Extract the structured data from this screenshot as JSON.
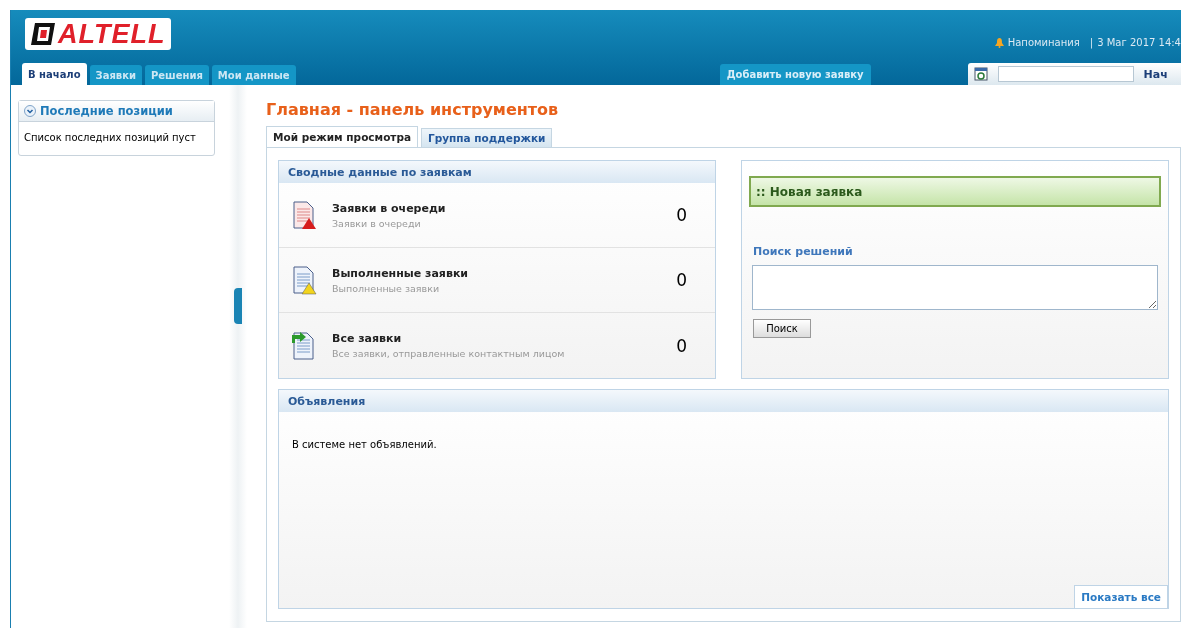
{
  "header": {
    "logo": "ALTELL",
    "reminders": "Напоминания",
    "separator": "|",
    "datetime": "3 Маг 2017 14:4",
    "add_button": "Добавить новую заявку",
    "search": {
      "button": "Нач"
    }
  },
  "nav_tabs": [
    {
      "label": "В начало",
      "selected": true
    },
    {
      "label": "Заявки",
      "selected": false
    },
    {
      "label": "Решения",
      "selected": false
    },
    {
      "label": "Мои данные",
      "selected": false
    }
  ],
  "sidebar": {
    "title": "Последние позиции",
    "expanded": true,
    "text": "Список последних позиций пуст"
  },
  "page_title": "Главная - панель инструментов",
  "view_tabs": [
    {
      "label": "Мой режим просмотра",
      "selected": true
    },
    {
      "label": "Группа поддержки",
      "selected": false
    }
  ],
  "summary": {
    "title": "Сводные данные по заявкам",
    "rows": [
      {
        "kind": "queue",
        "title": "Заявки в очереди",
        "subtitle": "Заявки в очереди",
        "count": "0"
      },
      {
        "kind": "done",
        "title": "Выполненные заявки",
        "subtitle": "Выполненные заявки",
        "count": "0"
      },
      {
        "kind": "all",
        "title": "Все заявки",
        "subtitle": "Все заявки, отправленные контактным лицом",
        "count": "0"
      }
    ]
  },
  "new_request": {
    "title": ":: Новая заявка",
    "search_label": "Поиск решений",
    "search_button": "Поиск"
  },
  "announcements": {
    "title": "Объявления",
    "text": "В системе нет объявлений.",
    "show_all": "Показать все"
  }
}
